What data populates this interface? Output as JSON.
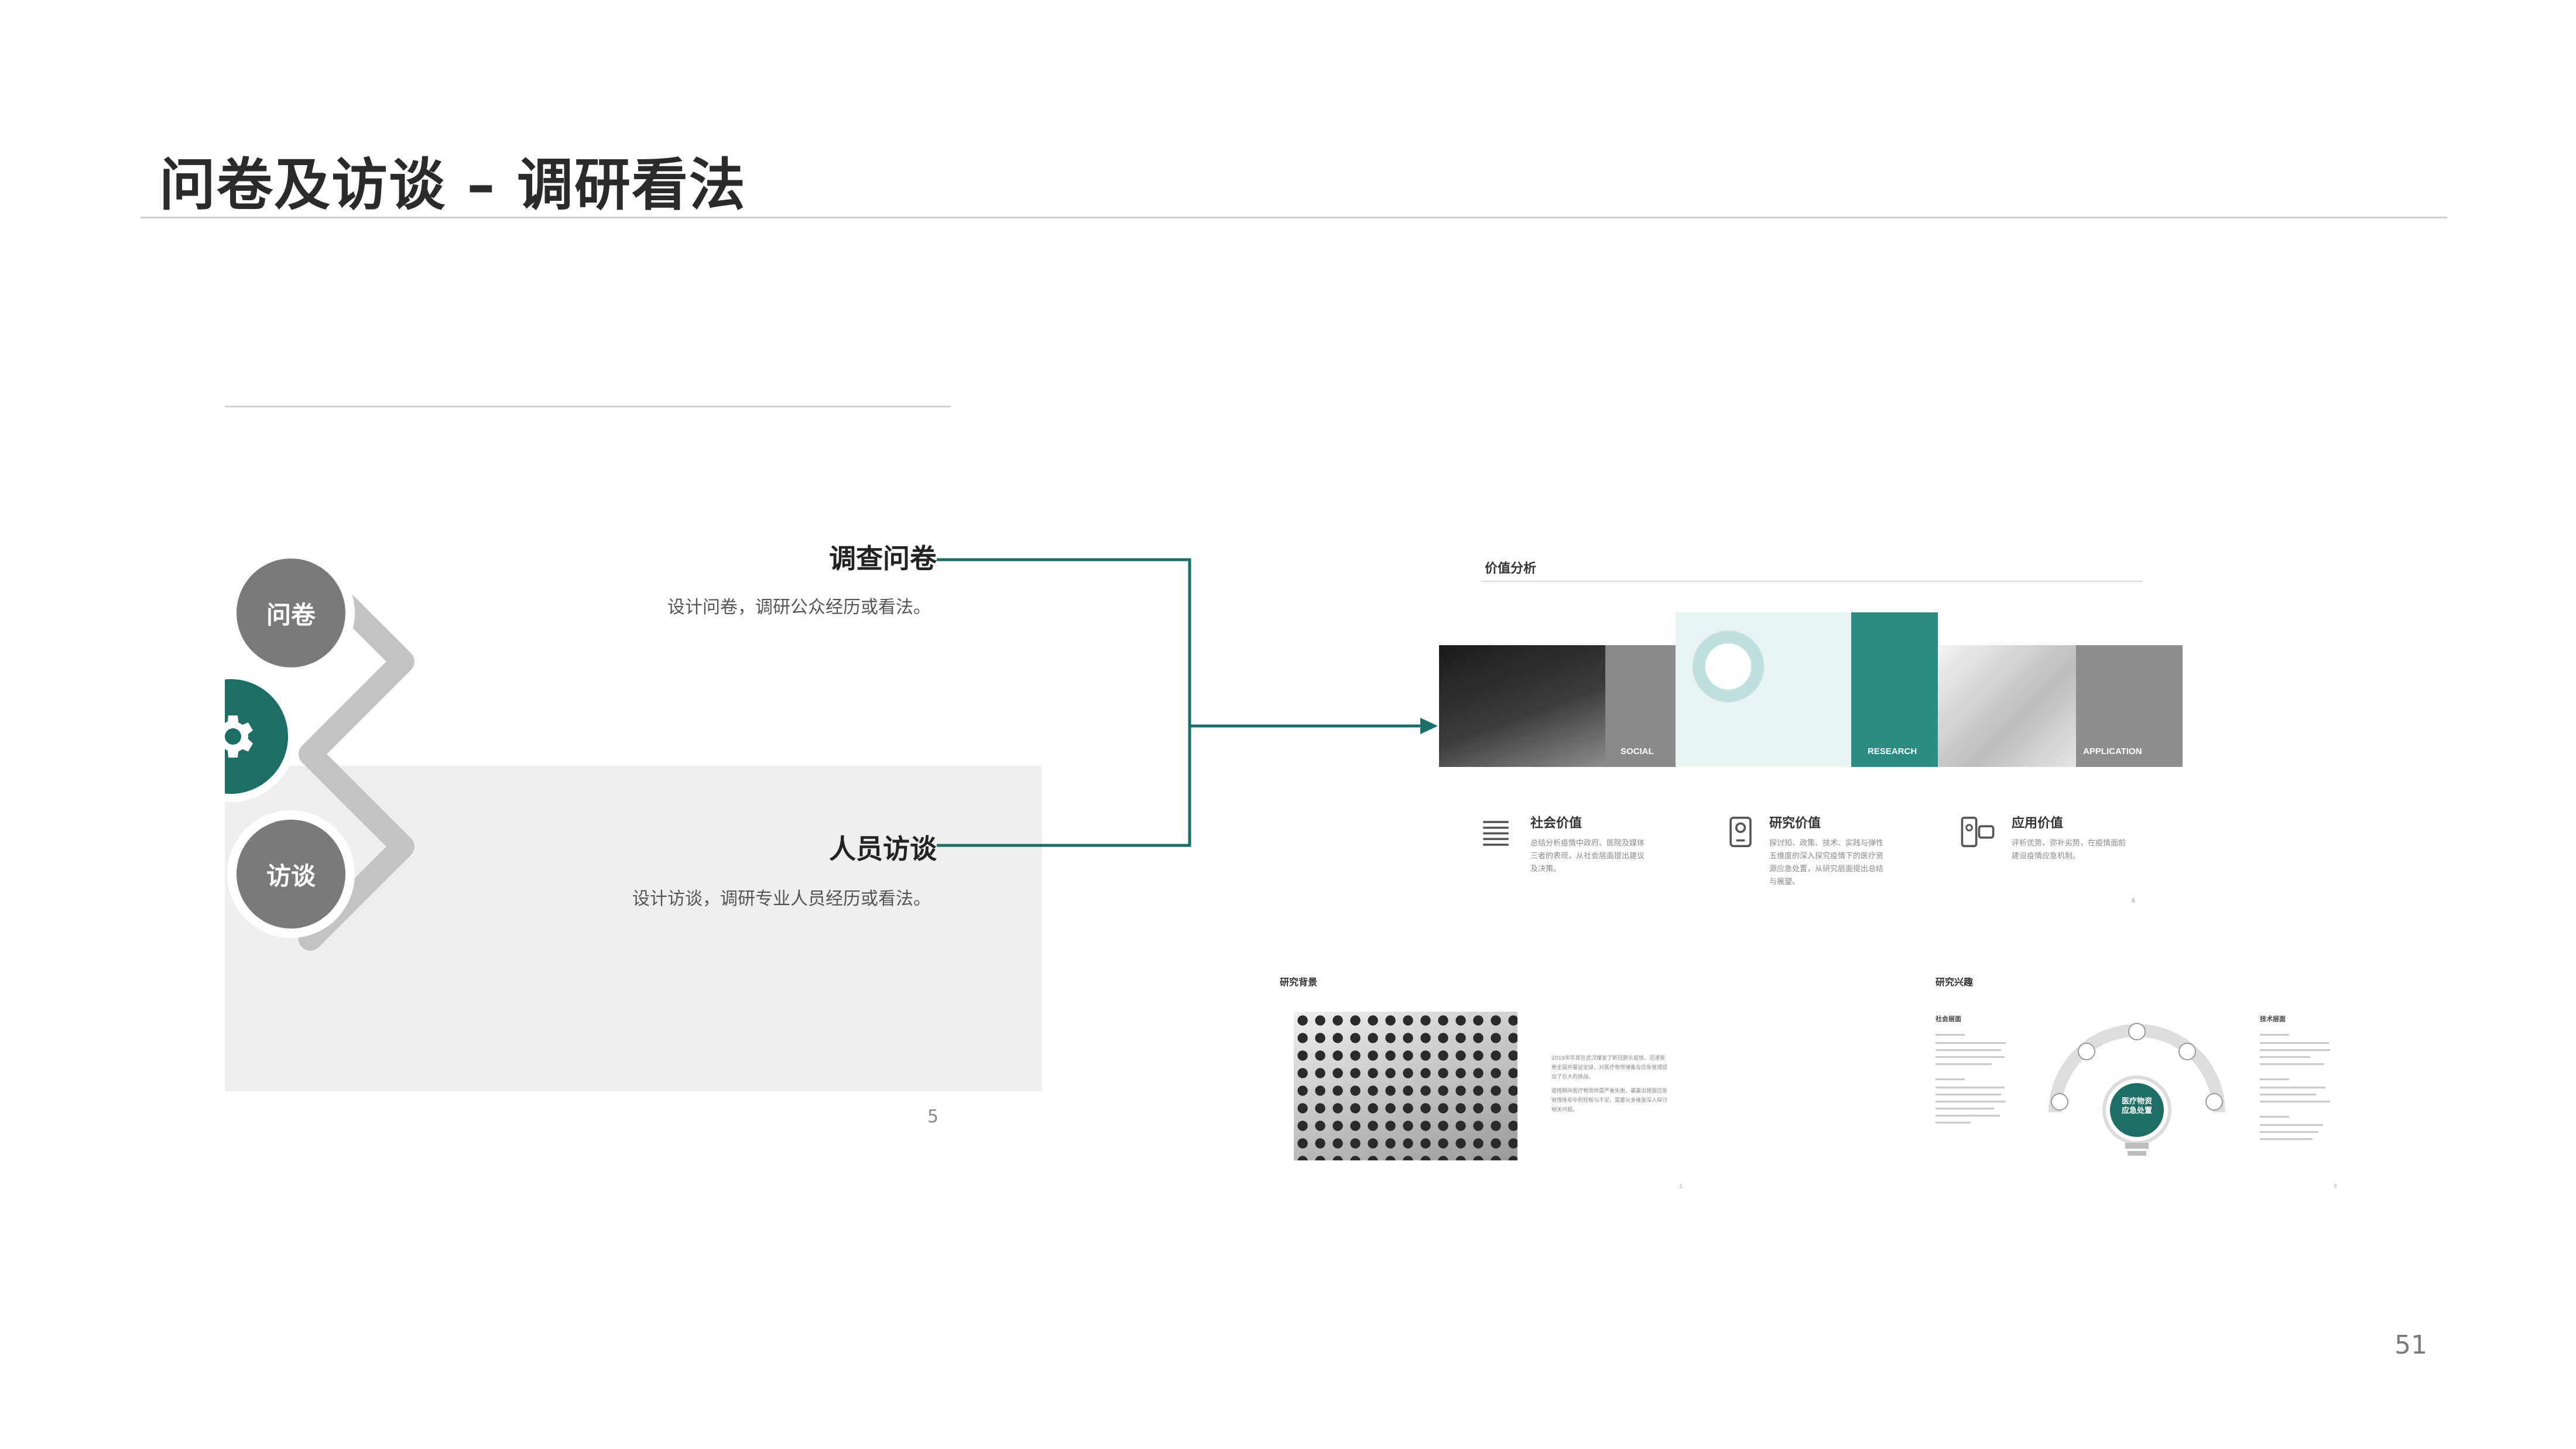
{
  "header": {
    "title": "问卷及访谈 – 调研看法"
  },
  "left_slide": {
    "circles": {
      "top": "问卷",
      "bottom": "访谈",
      "middle_icon": "gear-icon"
    },
    "items": [
      {
        "title": "调查问卷",
        "desc": "设计问卷，调研公众经历或看法。"
      },
      {
        "title": "人员访谈",
        "desc": "设计访谈，调研专业人员经历或看法。"
      }
    ],
    "page_number": "5"
  },
  "thumb_value": {
    "heading": "价值分析",
    "image_tags": [
      "SOCIAL",
      "RESEARCH",
      "APPLICATION"
    ],
    "columns": [
      {
        "icon": "document-list-icon",
        "title": "社会价值",
        "lines": [
          "总结分析疫情中政府、医院及媒体",
          "三者的表现，从社会层面提出建议",
          "及决策。"
        ]
      },
      {
        "icon": "phone-icon",
        "title": "研究价值",
        "lines": [
          "探讨知、政策、技术、实践与弹性",
          "五维度的深入探究疫情下的医疗资",
          "源应急处置，从研究层面提出总结",
          "与展望。"
        ]
      },
      {
        "icon": "devices-icon",
        "title": "应用价值",
        "lines": [
          "评析优势、弥补劣势，在疫情面前",
          "建设疫情应急机制。"
        ]
      }
    ],
    "page_number": "4"
  },
  "thumb_background": {
    "heading": "研究背景",
    "paragraphs": [
      "2019年年底在武汉爆发了新冠肺炎疫情，迅速席卷全国并蔓延全球，对医疗物资储备及应急管理提出了巨大的挑战。",
      "疫情期间医疗物资供需严重失衡，暴露出我国应急管理体系中的短板与不足，需要从多维度深入探讨相关问题。"
    ],
    "page_number": "2"
  },
  "thumb_interest": {
    "heading": "研究兴趣",
    "left_heading": "社会层面",
    "right_heading": "技术层面",
    "center": "医疗物资应急处置",
    "page_number": "3"
  },
  "footer": {
    "page_number": "51"
  },
  "colors": {
    "teal": "#1e6e68",
    "gray": "#7a7a7a"
  }
}
